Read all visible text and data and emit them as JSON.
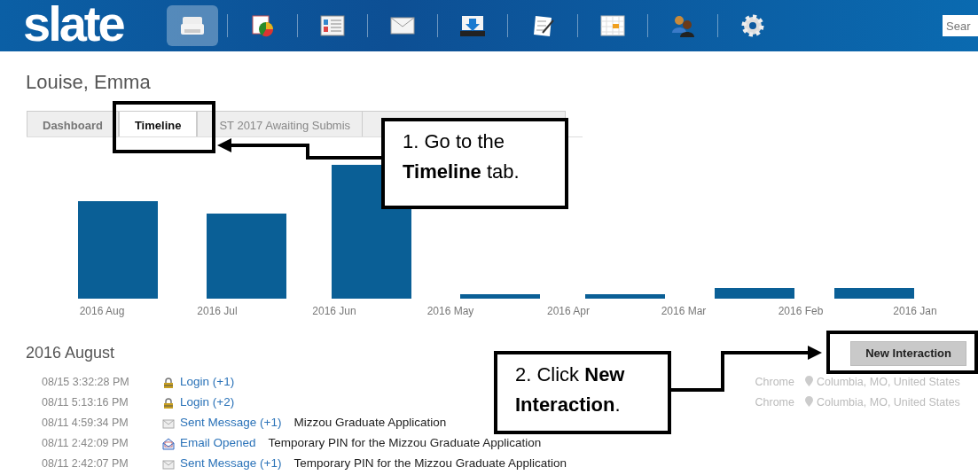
{
  "header": {
    "logo": "slate",
    "search": {
      "placeholder": "Sear"
    },
    "toolbar": [
      {
        "selected": true
      },
      {
        "selected": false
      },
      {
        "selected": false
      },
      {
        "selected": false
      },
      {
        "selected": false
      },
      {
        "selected": false
      },
      {
        "selected": false
      },
      {
        "selected": false
      },
      {
        "selected": false
      }
    ]
  },
  "person": {
    "name": "Louise, Emma"
  },
  "tabs": [
    {
      "label": "Dashboard",
      "selected": false
    },
    {
      "label": "Timeline",
      "selected": true
    },
    {
      "label": "ST 2017 Awaiting Submis",
      "selected": false
    }
  ],
  "timeline_chart": {
    "categories": [
      "2016 Aug",
      "2016 Jul",
      "2016 Jun",
      "2016 May",
      "2016 Apr",
      "2016 Mar",
      "2016 Feb",
      "2016 Jan"
    ]
  },
  "section": {
    "title": "2016 August",
    "button": "New Interaction"
  },
  "events": [
    {
      "time": "08/15 3:32:28 PM",
      "kind": "login",
      "action": "Login (+1)",
      "browser": "Chrome",
      "location": "Columbia, MO, United States"
    },
    {
      "time": "08/11 5:13:16 PM",
      "kind": "login",
      "action": "Login (+2)",
      "browser": "Chrome",
      "location": "Columbia, MO, United States"
    },
    {
      "time": "08/11 4:59:34 PM",
      "kind": "sent",
      "action": "Sent Message (+1)",
      "description": "Mizzou Graduate Application"
    },
    {
      "time": "08/11 2:42:09 PM",
      "kind": "opened",
      "action": "Email Opened",
      "description": "Temporary PIN for the Mizzou Graduate Application"
    },
    {
      "time": "08/11 2:42:07 PM",
      "kind": "sent",
      "action": "Sent Message (+1)",
      "description": "Temporary PIN for the Mizzou Graduate Application"
    }
  ],
  "callouts": [
    {
      "text": "1. Go to the **Timeline** tab."
    },
    {
      "text": "2. Click **New Interaction**."
    }
  ]
}
